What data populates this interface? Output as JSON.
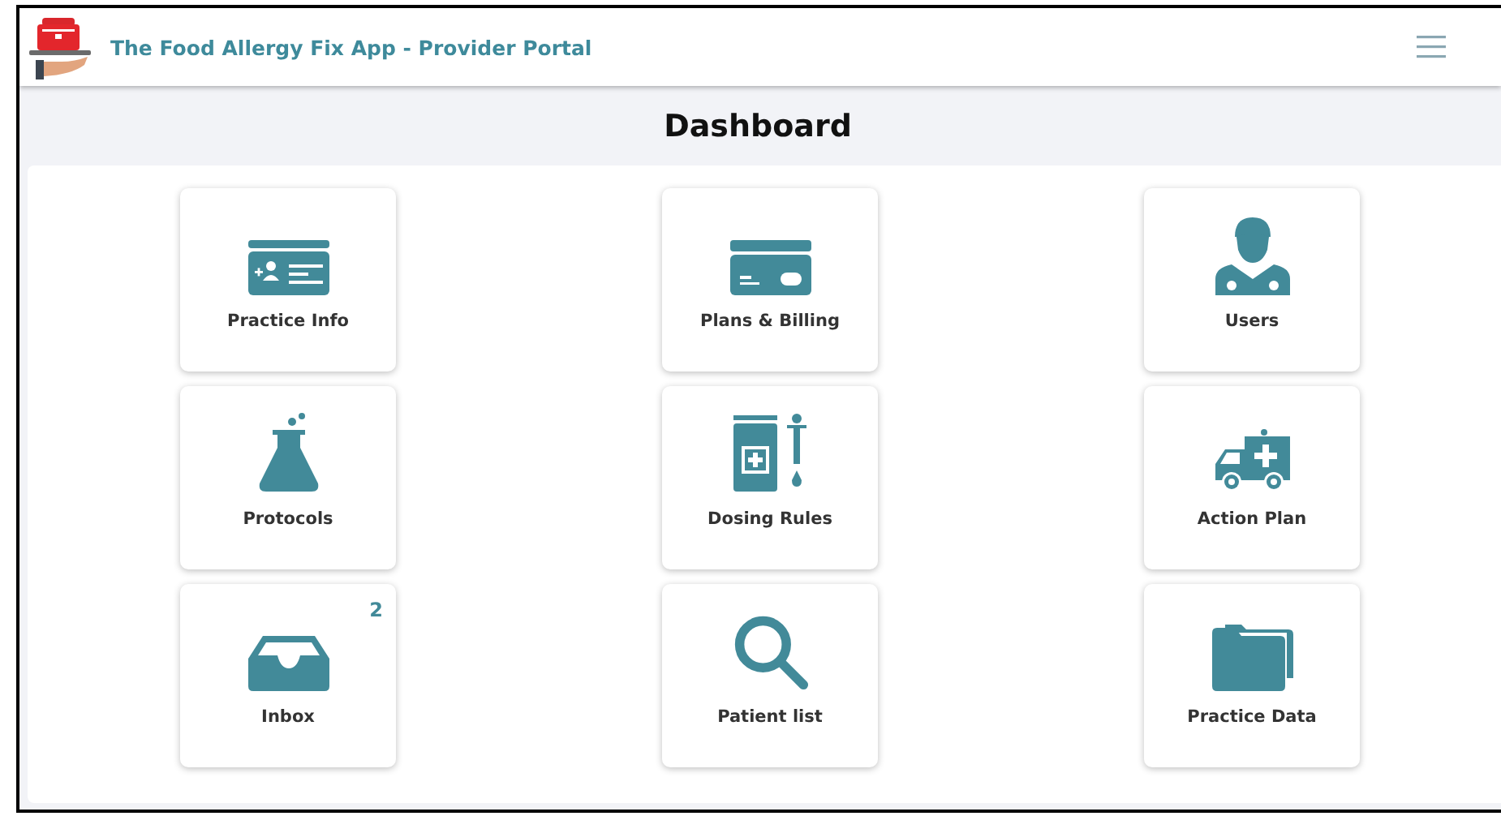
{
  "header": {
    "title": "The Food Allergy Fix App - Provider Portal"
  },
  "page_title": "Dashboard",
  "tiles": [
    {
      "label": "Practice Info",
      "kind": "id-card"
    },
    {
      "label": "Plans & Billing",
      "kind": "credit-card"
    },
    {
      "label": "Users",
      "kind": "doctor"
    },
    {
      "label": "Protocols",
      "kind": "flask"
    },
    {
      "label": "Dosing Rules",
      "kind": "medicine"
    },
    {
      "label": "Action Plan",
      "kind": "ambulance"
    },
    {
      "label": "Inbox",
      "kind": "inbox",
      "badge": "2"
    },
    {
      "label": "Patient list",
      "kind": "search"
    },
    {
      "label": "Practice Data",
      "kind": "folders"
    }
  ]
}
